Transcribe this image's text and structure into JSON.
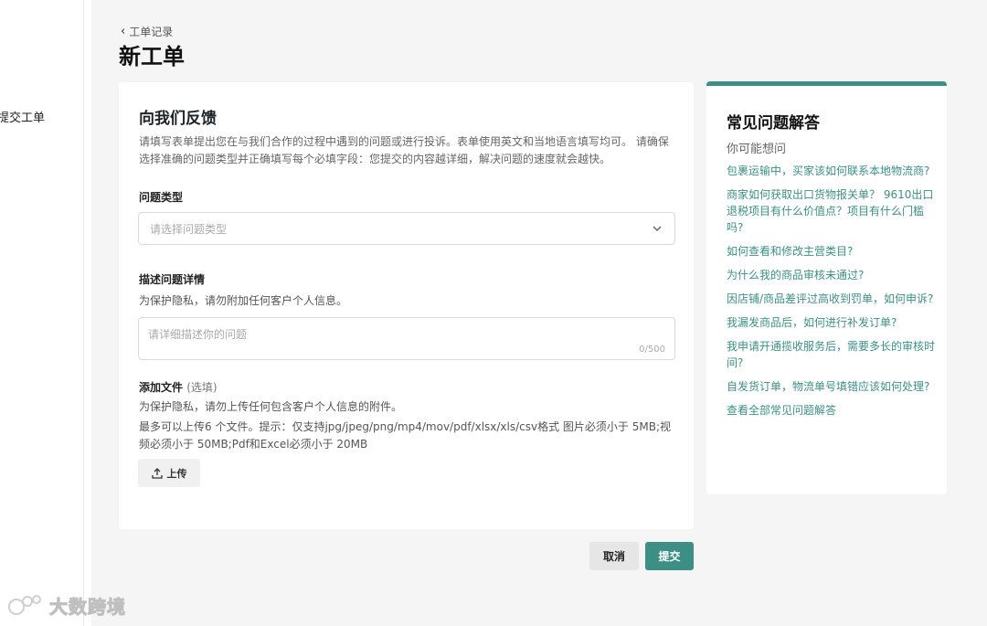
{
  "sidebar": {
    "active_item": "提交工单"
  },
  "header": {
    "breadcrumb": "工单记录",
    "title": "新工单"
  },
  "form": {
    "title": "向我们反馈",
    "intro": "请填写表单提出您在与我们合作的过程中遇到的问题或进行投诉。表单使用英文和当地语言填写均可。 请确保选择准确的问题类型并正确填写每个必填字段：您提交的内容越详细，解决问题的速度就会越快。",
    "issue_type": {
      "label": "问题类型",
      "placeholder": "请选择问题类型"
    },
    "description": {
      "label": "描述问题详情",
      "hint": "为保护隐私，请勿附加任何客户个人信息。",
      "placeholder": "请详细描述你的问题",
      "counter": "0/500"
    },
    "attachments": {
      "label": "添加文件",
      "optional": "(选填)",
      "hint_privacy": "为保护隐私，请勿上传任何包含客户个人信息的附件。",
      "hint_limits": "最多可以上传6 个文件。提示：仅支持jpg/jpeg/png/mp4/mov/pdf/xlsx/xls/csv格式 图片必须小于 5MB;视频必须小于 50MB;Pdf和Excel必须小于 20MB",
      "upload_label": "上传"
    },
    "cancel_label": "取消",
    "submit_label": "提交"
  },
  "faq": {
    "title": "常见问题解答",
    "subtitle": "你可能想问",
    "items": [
      "包裹运输中，买家该如何联系本地物流商?",
      "商家如何获取出口货物报关单？ 9610出口退税项目有什么价值点？项目有什么门槛吗?",
      "如何查看和修改主营类目?",
      "为什么我的商品审核未通过?",
      "因店铺/商品差评过高收到罚单，如何申诉?",
      "我漏发商品后，如何进行补发订单?",
      "我申请开通揽收服务后，需要多长的审核时间?",
      "自发货订单，物流单号填错应该如何处理?",
      "查看全部常见问题解答"
    ]
  },
  "watermark": {
    "text": "大数跨境"
  },
  "colors": {
    "accent": "#3d8f85",
    "background": "#f5f5f5"
  }
}
